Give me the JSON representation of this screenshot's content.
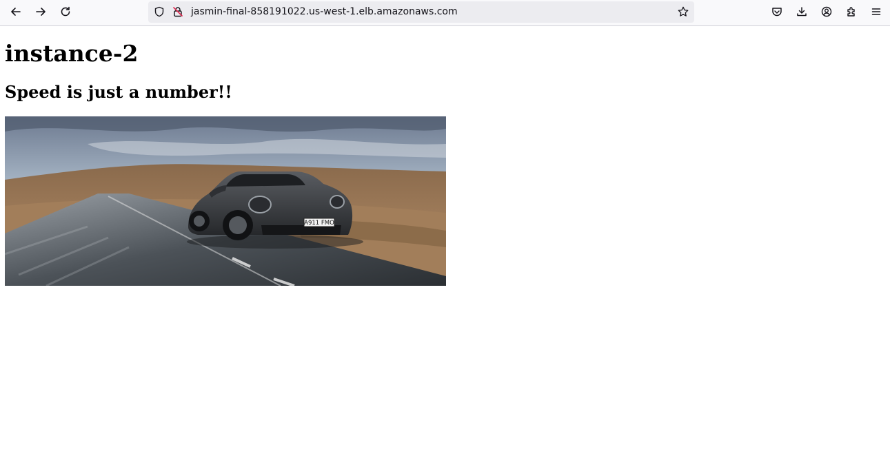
{
  "browser": {
    "url": "jasmin-final-858191022.us-west-1.elb.amazonaws.com",
    "icons": {
      "back": "arrow-left-icon",
      "forward": "arrow-right-icon",
      "reload": "reload-icon",
      "tracking": "shield-icon",
      "connection": "insecure-lock-icon",
      "bookmark": "star-icon",
      "pocket": "pocket-icon",
      "downloads": "download-icon",
      "account": "account-icon",
      "extensions": "puzzle-icon",
      "menu": "hamburger-menu-icon"
    }
  },
  "page": {
    "heading": "instance-2",
    "subheading": "Speed is just a number!!",
    "image": {
      "subject": "dark grey sports car on a moorland road",
      "plate": "A911 FMO"
    }
  }
}
